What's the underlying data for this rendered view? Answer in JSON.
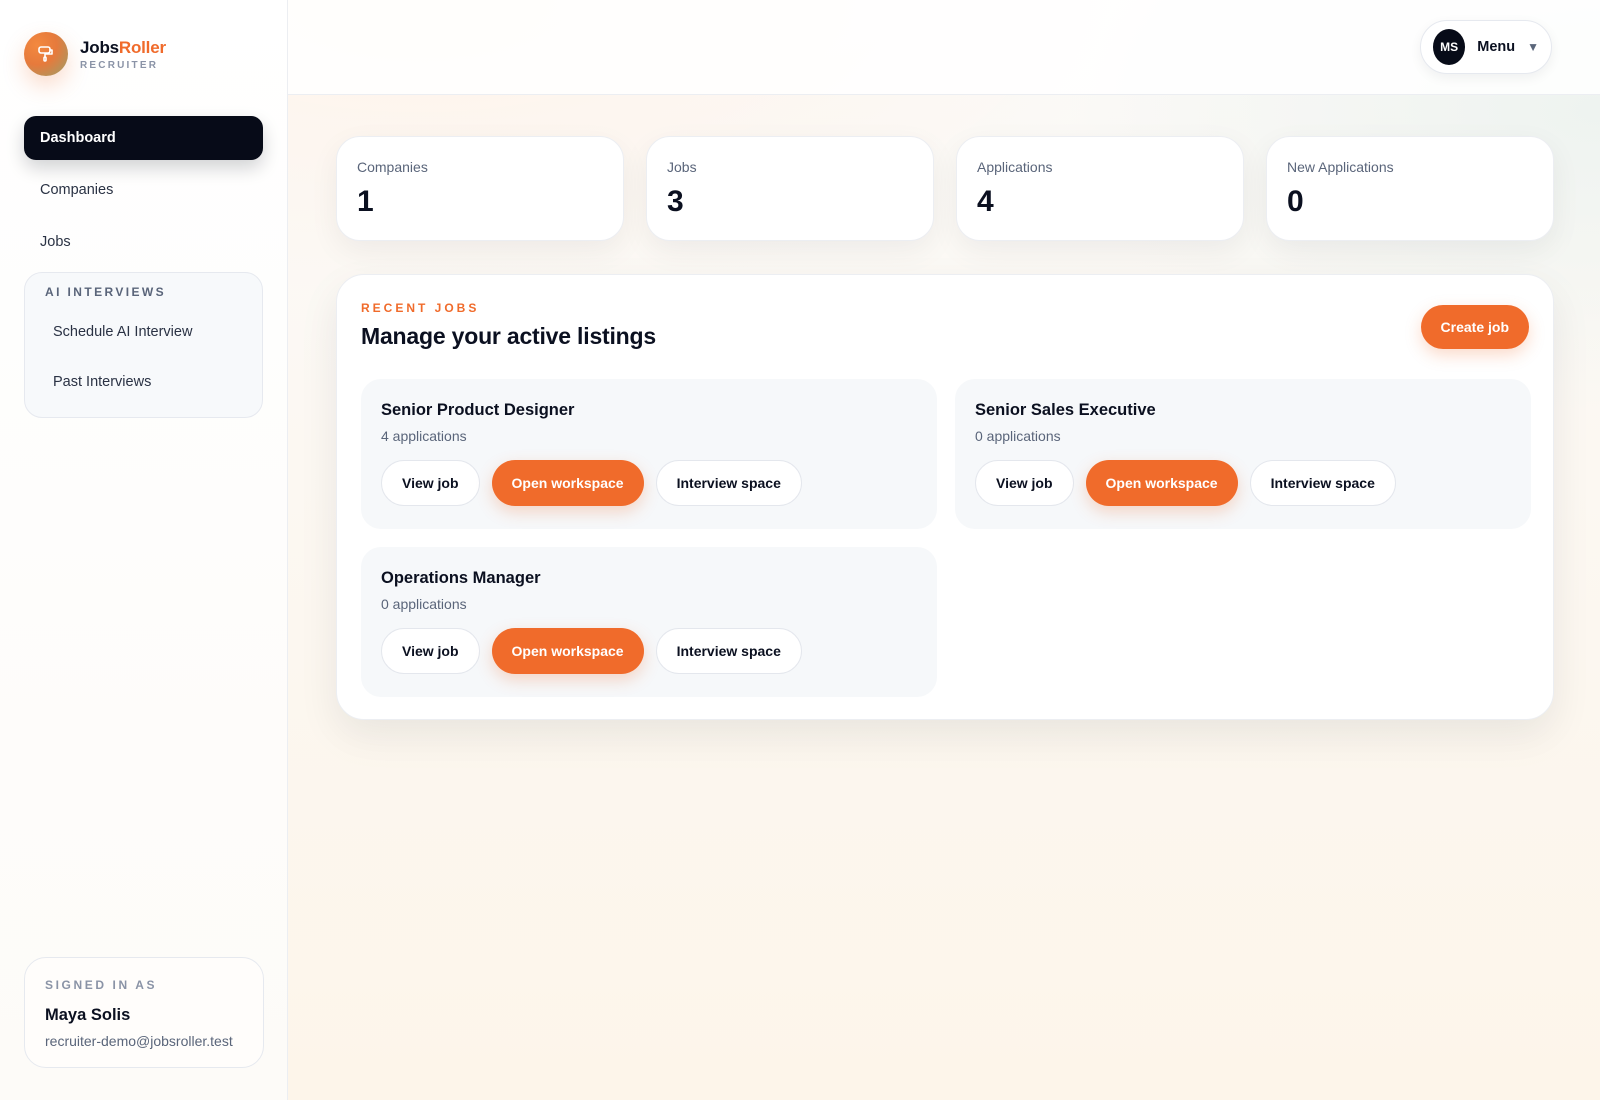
{
  "brand": {
    "name_part1": "Jobs",
    "name_part2": "Roller",
    "subtitle": "RECRUITER",
    "brand_color": "#f06b2b"
  },
  "sidebar": {
    "items": [
      {
        "label": "Dashboard",
        "active": true
      },
      {
        "label": "Companies",
        "active": false
      },
      {
        "label": "Jobs",
        "active": false
      }
    ],
    "ai_section": {
      "title": "AI INTERVIEWS",
      "items": [
        {
          "label": "Schedule AI Interview"
        },
        {
          "label": "Past Interviews"
        }
      ]
    },
    "signed_in": {
      "label": "SIGNED IN AS",
      "name": "Maya Solis",
      "email": "recruiter-demo@jobsroller.test"
    }
  },
  "topbar": {
    "avatar_initials": "MS",
    "menu_label": "Menu",
    "menu_icon": "chevron-down-icon"
  },
  "stats": [
    {
      "label": "Companies",
      "value": "1"
    },
    {
      "label": "Jobs",
      "value": "3"
    },
    {
      "label": "Applications",
      "value": "4"
    },
    {
      "label": "New Applications",
      "value": "0"
    }
  ],
  "recent_jobs": {
    "eyebrow": "RECENT JOBS",
    "title": "Manage your active listings",
    "create_label": "Create job",
    "jobs": [
      {
        "title": "Senior Product Designer",
        "applications": "4 applications",
        "view_label": "View job",
        "workspace_label": "Open workspace",
        "interview_label": "Interview space"
      },
      {
        "title": "Senior Sales Executive",
        "applications": "0 applications",
        "view_label": "View job",
        "workspace_label": "Open workspace",
        "interview_label": "Interview space"
      },
      {
        "title": "Operations Manager",
        "applications": "0 applications",
        "view_label": "View job",
        "workspace_label": "Open workspace",
        "interview_label": "Interview space"
      }
    ]
  },
  "colors": {
    "accent": "#f06b2b",
    "dark": "#070b18",
    "text_muted": "#5a657a"
  }
}
